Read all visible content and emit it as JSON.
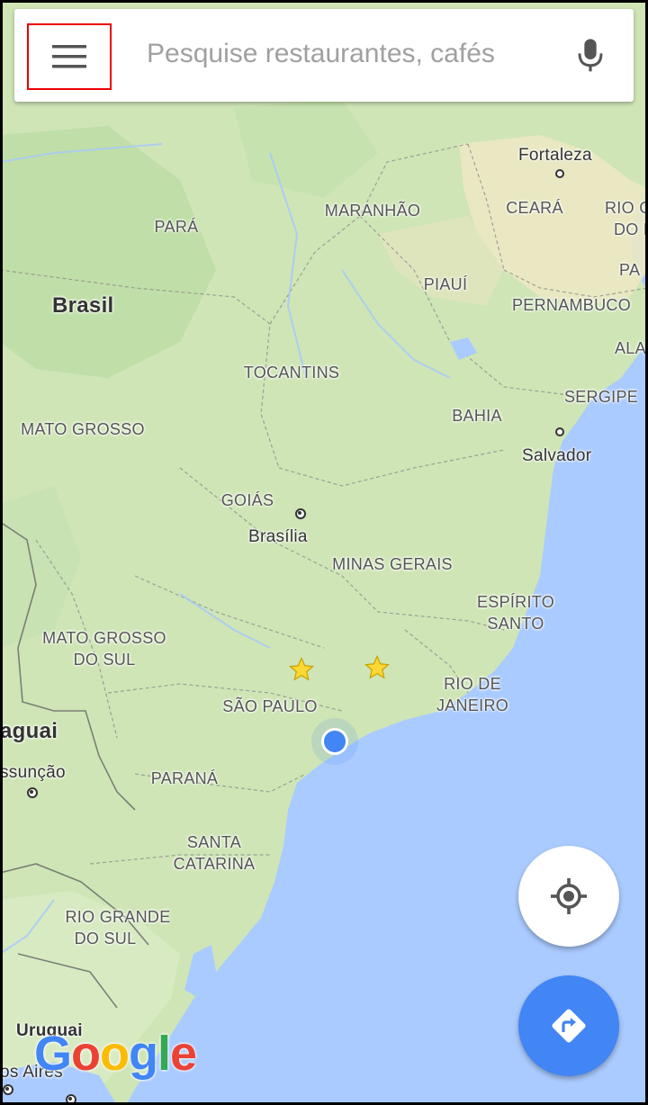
{
  "search": {
    "placeholder": "Pesquise restaurantes, cafés",
    "menu_icon": "hamburger-menu-icon",
    "mic_icon": "microphone-icon"
  },
  "map": {
    "country_labels": [
      {
        "name": "brasil",
        "text": "Brasil"
      },
      {
        "name": "paraguai",
        "text": "aguai"
      },
      {
        "name": "uruguai",
        "text": "Uruguai"
      }
    ],
    "state_labels": [
      {
        "name": "para",
        "lines": [
          "PARÁ"
        ]
      },
      {
        "name": "maranhao",
        "lines": [
          "MARANHÃO"
        ]
      },
      {
        "name": "ceara",
        "lines": [
          "CEARÁ"
        ]
      },
      {
        "name": "rio-grande-do-norte",
        "lines": [
          "RIO G",
          "DO N"
        ]
      },
      {
        "name": "piaui",
        "lines": [
          "PIAUÍ"
        ]
      },
      {
        "name": "paraiba",
        "lines": [
          "PA"
        ]
      },
      {
        "name": "pernambuco",
        "lines": [
          "PERNAMBUCO"
        ]
      },
      {
        "name": "alagoas",
        "lines": [
          "ALA"
        ]
      },
      {
        "name": "tocantins",
        "lines": [
          "TOCANTINS"
        ]
      },
      {
        "name": "sergipe",
        "lines": [
          "SERGIPE"
        ]
      },
      {
        "name": "mato-grosso",
        "lines": [
          "MATO GROSSO"
        ]
      },
      {
        "name": "bahia",
        "lines": [
          "BAHIA"
        ]
      },
      {
        "name": "goias",
        "lines": [
          "GOIÁS"
        ]
      },
      {
        "name": "minas-gerais",
        "lines": [
          "MINAS GERAIS"
        ]
      },
      {
        "name": "espirito-santo",
        "lines": [
          "ESPÍRITO",
          "SANTO"
        ]
      },
      {
        "name": "mato-grosso-do-sul",
        "lines": [
          "MATO GROSSO",
          "DO SUL"
        ]
      },
      {
        "name": "rio-de-janeiro",
        "lines": [
          "RIO DE",
          "JANEIRO"
        ]
      },
      {
        "name": "sao-paulo",
        "lines": [
          "SÃO PAULO"
        ]
      },
      {
        "name": "parana",
        "lines": [
          "PARANÁ"
        ]
      },
      {
        "name": "santa-catarina",
        "lines": [
          "SANTA",
          "CATARINA"
        ]
      },
      {
        "name": "rio-grande-do-sul",
        "lines": [
          "RIO GRANDE",
          "DO SUL"
        ]
      }
    ],
    "city_labels": [
      {
        "name": "fortaleza",
        "text": "Fortaleza"
      },
      {
        "name": "salvador",
        "text": "Salvador"
      },
      {
        "name": "brasilia",
        "text": "Brasília"
      },
      {
        "name": "assuncao",
        "text": "ssunção"
      },
      {
        "name": "buenos-aires",
        "text": "os Aires"
      }
    ],
    "starred_places": 2,
    "colors": {
      "water": "#aacbff",
      "land": "#cfe5b6",
      "dry_land": "#ebe8c4",
      "accent": "#4285f4",
      "my_location": "#4285f4"
    }
  },
  "controls": {
    "my_location_icon": "crosshair-icon",
    "directions_icon": "directions-icon"
  },
  "branding": {
    "logo_text": "Google"
  }
}
